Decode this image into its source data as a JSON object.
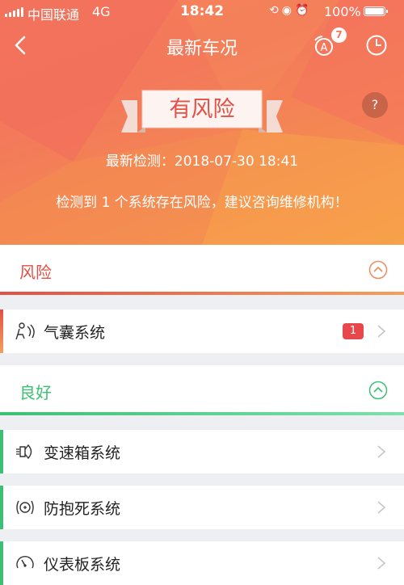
{
  "status_bar": {
    "carrier": "中国联通",
    "network": "4G",
    "time": "18:42",
    "battery_text": "100%",
    "battery_level": 1.0
  },
  "header": {
    "title": "最新车况",
    "ab_badge_count": "7",
    "help_label": "?"
  },
  "status": {
    "result_label": "有风险",
    "detect_time": "最新检测：2018-07-30 18:41",
    "message": "检测到 1 个系统存在风险，建议咨询维修机构！"
  },
  "sections": {
    "risk": {
      "label": "风险",
      "color": "#e25046",
      "items": [
        {
          "name": "气囊系统",
          "icon": "airbag-icon",
          "count": "1"
        }
      ]
    },
    "good": {
      "label": "良好",
      "color": "#3cc073",
      "items": [
        {
          "name": "变速箱系统",
          "icon": "transmission-icon"
        },
        {
          "name": "防抱死系统",
          "icon": "abs-icon"
        },
        {
          "name": "仪表板系统",
          "icon": "dashboard-icon"
        }
      ]
    }
  },
  "colors": {
    "header_gradient_start": "#f57a5a",
    "header_gradient_end": "#f6a04a",
    "risk_accent": "#e25046",
    "good_accent": "#3cc073",
    "badge_red": "#e8484c",
    "page_background": "#eeeff3"
  }
}
